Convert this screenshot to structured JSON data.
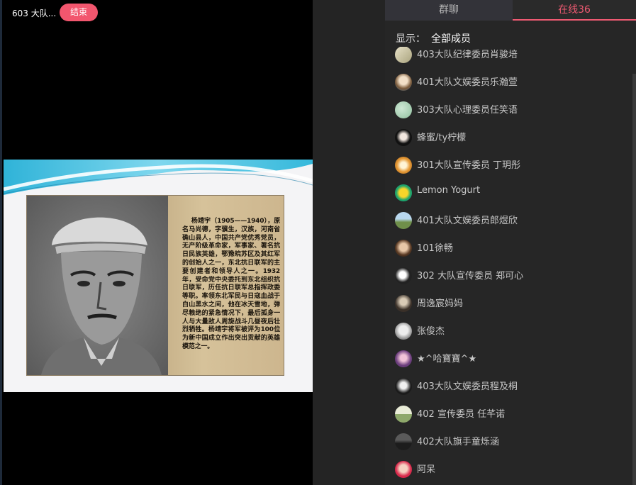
{
  "stage": {
    "room_title": "603 大队...",
    "end_label": "结束",
    "slide": {
      "bio_text": "    杨靖宇（1905——1940），原名马尚德，字骥生，汉族，河南省确山县人，中国共产党优秀党员，无产阶级革命家，军事家、著名抗日民族英雄，鄂豫皖苏区及其红军的创始人之一，东北抗日联军的主要创建者和领导人之一。1932年，受命党中央委托到东北组织抗日联军，历任抗日联军总指挥政委等职。率领东北军民与日寇血战于白山黑水之间，他在冰天雪地，弹尽粮绝的紧急情况下，最后孤身一人与大量敌人周旋战斗几昼夜后壮烈牺牲。杨靖宇将军被评为100位为新中国成立作出突出贡献的英雄模范之一。"
    }
  },
  "panel": {
    "tabs": [
      {
        "label": "群聊",
        "active": false
      },
      {
        "label": "在线36",
        "active": true
      }
    ],
    "filter_label": "显示：",
    "filter_value": "全部成员",
    "accent_color": "#ef5a72",
    "members": [
      {
        "name": "403大队纪律委员肖骏培",
        "avatar": "avatar-sketch"
      },
      {
        "name": "401大队文娱委员乐瀚萱",
        "avatar": "avatar-girl"
      },
      {
        "name": "303大队心理委员任笑语",
        "avatar": "avatar-green"
      },
      {
        "name": "蜂蜜/ty柠檬",
        "avatar": "avatar-dark"
      },
      {
        "name": "301大队宣传委员 丁玥彤",
        "avatar": "avatar-tiger"
      },
      {
        "name": "Lemon Yogurt",
        "avatar": "avatar-duck"
      },
      {
        "name": "401大队文娱委员郎煜欣",
        "avatar": "avatar-field"
      },
      {
        "name": "101徐畅",
        "avatar": "avatar-kid"
      },
      {
        "name": "302 大队宣传委员 郑可心",
        "avatar": "avatar-mono"
      },
      {
        "name": "周逸宸妈妈",
        "avatar": "avatar-portrait"
      },
      {
        "name": "张俊杰",
        "avatar": "avatar-grey"
      },
      {
        "name": "★^哈寶寶^★",
        "avatar": "avatar-purple"
      },
      {
        "name": "403大队文娱委员程及桐",
        "avatar": "avatar-bw"
      },
      {
        "name": "402 宣传委员 任芊诺",
        "avatar": "avatar-landscape"
      },
      {
        "name": "402大队旗手童烁涵",
        "avatar": "avatar-road"
      },
      {
        "name": "阿呆",
        "avatar": "avatar-baby"
      }
    ]
  }
}
